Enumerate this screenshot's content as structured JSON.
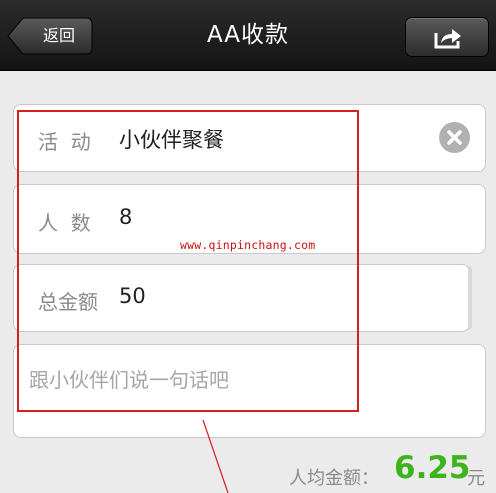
{
  "nav": {
    "title": "AA收款",
    "back_label": "返回",
    "share_icon": "share-icon"
  },
  "form": {
    "activity": {
      "label": "活  动",
      "value": "小伙伴聚餐",
      "clear_icon": "clear-icon"
    },
    "people": {
      "label": "人  数",
      "value": "8"
    },
    "total": {
      "label": "总金额",
      "value": "50"
    },
    "message": {
      "placeholder": "跟小伙伴们说一句话吧"
    }
  },
  "watermark": "www.qinpinchang.com",
  "summary": {
    "label": "人均金额：",
    "value": "6.25",
    "unit": "元"
  },
  "colors": {
    "nav_background": "#1e1e1e",
    "amount_green": "#3cb51d",
    "annotation_red": "#d81f1f",
    "watermark_red": "#cc1010"
  }
}
